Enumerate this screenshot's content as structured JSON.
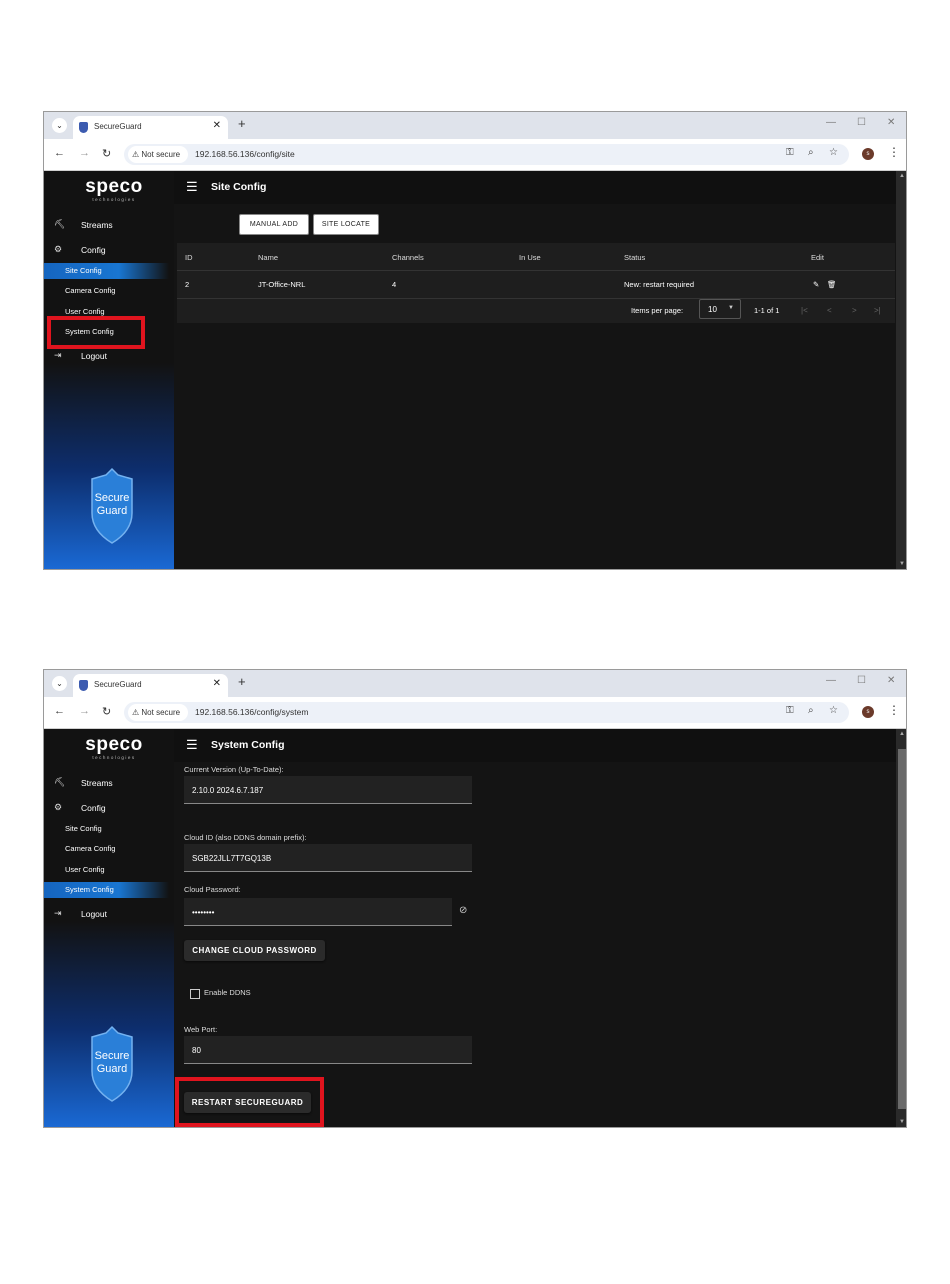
{
  "browser": {
    "tab_title": "SecureGuard",
    "not_secure": "Not secure",
    "url_site": "192.168.56.136/config/site",
    "url_system": "192.168.56.136/config/system",
    "profile_initial": "s"
  },
  "logo": {
    "main": "speco",
    "sub": "technologies"
  },
  "sidebar": {
    "streams": "Streams",
    "config": "Config",
    "site_config": "Site Config",
    "camera_config": "Camera Config",
    "user_config": "User Config",
    "system_config": "System Config",
    "logout": "Logout",
    "badge_line1": "Secure",
    "badge_line2": "Guard"
  },
  "site_page": {
    "title": "Site Config",
    "manual_add": "MANUAL ADD",
    "site_locate": "SITE LOCATE",
    "columns": [
      "ID",
      "Name",
      "Channels",
      "In Use",
      "Status",
      "Edit"
    ],
    "rows": [
      {
        "id": "2",
        "name": "JT-Office-NRL",
        "channels": "4",
        "in_use": "",
        "status": "New: restart required"
      }
    ],
    "items_per_page_label": "Items per page:",
    "items_per_page": "10",
    "range": "1-1 of 1"
  },
  "system_page": {
    "title": "System Config",
    "version_label": "Current Version (Up-To-Date):",
    "version_value": "2.10.0 2024.6.7.187",
    "cloud_id_label": "Cloud ID (also DDNS domain prefix):",
    "cloud_id_value": "SGB22JLL7T7GQ13B",
    "cloud_password_label": "Cloud Password:",
    "cloud_password_value": "••••••••",
    "change_password_button": "CHANGE CLOUD PASSWORD",
    "enable_ddns_label": "Enable DDNS",
    "enable_ddns_checked": false,
    "web_port_label": "Web Port:",
    "web_port_value": "80",
    "restart_button": "RESTART SECUREGUARD"
  },
  "colors": {
    "highlight": "#e0141e",
    "active_nav": "#1976d2",
    "sidebar_bottom": "#1a6ad6",
    "page_bg": "#141414"
  }
}
